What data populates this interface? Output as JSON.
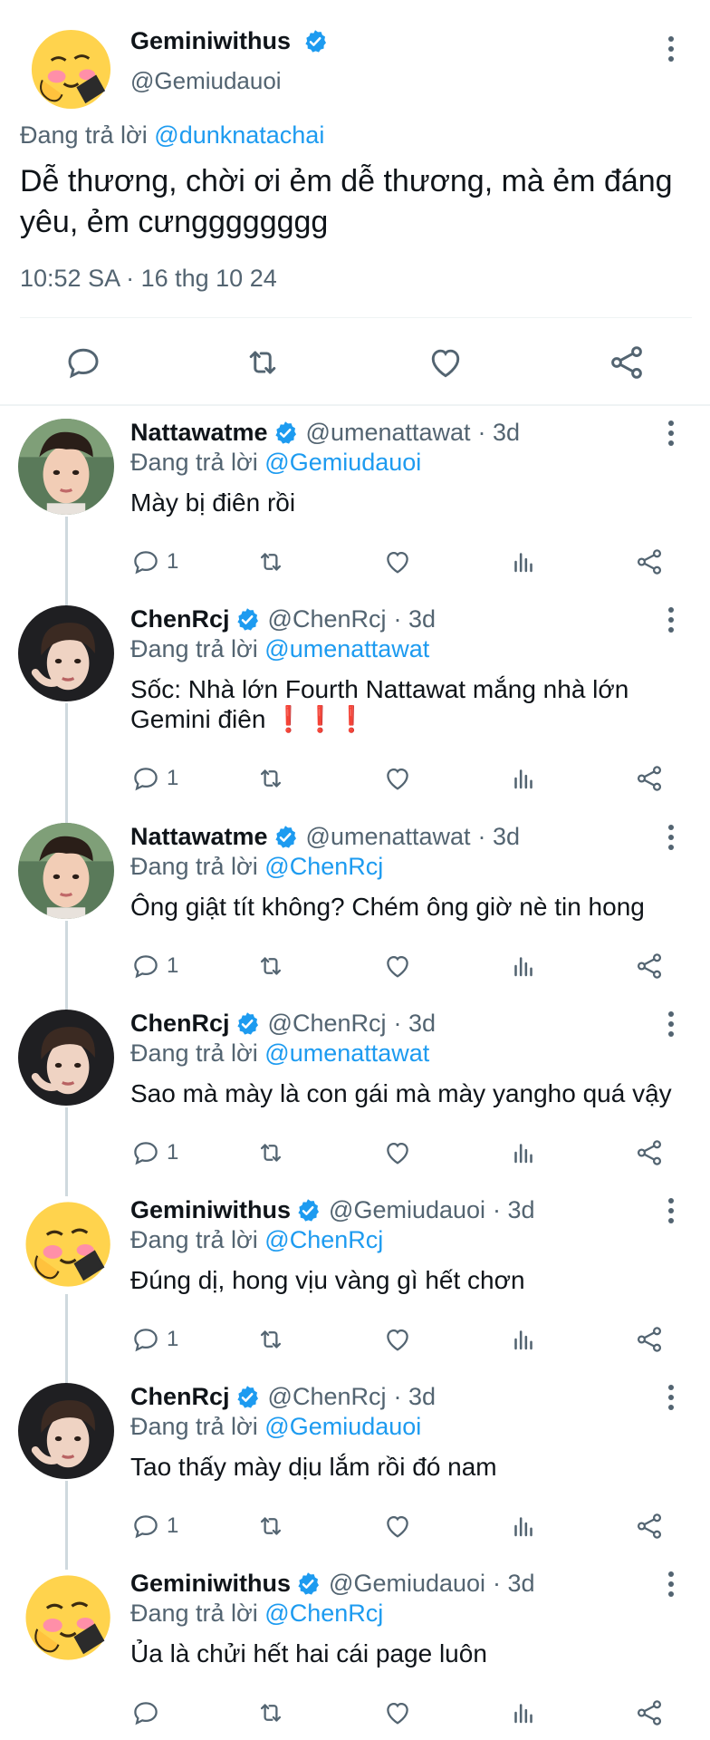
{
  "main_tweet": {
    "display_name": "Geminiwithus",
    "handle": "@Gemiudauoi",
    "reply_prefix": "Đang trả lời",
    "reply_to": "@dunknatachai",
    "text": "Dễ thương, chời ơi ẻm dễ thương, mà ẻm đáng yêu, ẻm cưngggggggg",
    "timestamp": "10:52 SA · 16 thg 10 24"
  },
  "replies": [
    {
      "display_name": "Nattawatme",
      "handle": "@umenattawat",
      "age": "· 3d",
      "reply_prefix": "Đang trả lời",
      "reply_to": "@Gemiudauoi",
      "text": "Mày bị điên rồi",
      "reply_count": "1",
      "avatar": "nattawat"
    },
    {
      "display_name": "ChenRcj",
      "handle": "@ChenRcj",
      "age": "· 3d",
      "reply_prefix": "Đang trả lời",
      "reply_to": "@umenattawat",
      "text": "Sốc: Nhà lớn Fourth Nattawat mắng nhà lớn Gemini điên ❗❗❗",
      "reply_count": "1",
      "avatar": "chen"
    },
    {
      "display_name": "Nattawatme",
      "handle": "@umenattawat",
      "age": "· 3d",
      "reply_prefix": "Đang trả lời",
      "reply_to": "@ChenRcj",
      "text": "Ông giật tít không? Chém ông giờ nè tin hong",
      "reply_count": "1",
      "avatar": "nattawat"
    },
    {
      "display_name": "ChenRcj",
      "handle": "@ChenRcj",
      "age": "· 3d",
      "reply_prefix": "Đang trả lời",
      "reply_to": "@umenattawat",
      "text": "Sao mà mày là con gái mà mày yangho quá vậy",
      "reply_count": "1",
      "avatar": "chen"
    },
    {
      "display_name": "Geminiwithus",
      "handle": "@Gemiudauoi",
      "age": "· 3d",
      "reply_prefix": "Đang trả lời",
      "reply_to": "@ChenRcj",
      "text": "Đúng dị, hong vịu vàng gì hết chơn",
      "reply_count": "1",
      "avatar": "gemini"
    },
    {
      "display_name": "ChenRcj",
      "handle": "@ChenRcj",
      "age": "· 3d",
      "reply_prefix": "Đang trả lời",
      "reply_to": "@Gemiudauoi",
      "text": "Tao thấy mày dịu lắm rồi đó nam",
      "reply_count": "1",
      "avatar": "chen"
    },
    {
      "display_name": "Geminiwithus",
      "handle": "@Gemiudauoi",
      "age": "· 3d",
      "reply_prefix": "Đang trả lời",
      "reply_to": "@ChenRcj",
      "text": "Ủa là chửi hết hai cái page luôn",
      "reply_count": "",
      "avatar": "gemini"
    }
  ],
  "icons": {
    "reply": "reply-icon",
    "retweet": "retweet-icon",
    "like": "heart-icon",
    "views": "views-icon",
    "share": "share-icon",
    "verified": "verified-badge-icon",
    "more": "more-icon"
  },
  "colors": {
    "link": "#1d9bf0",
    "muted": "#536471",
    "text": "#0f1419",
    "verified": "#1d9bf0"
  }
}
